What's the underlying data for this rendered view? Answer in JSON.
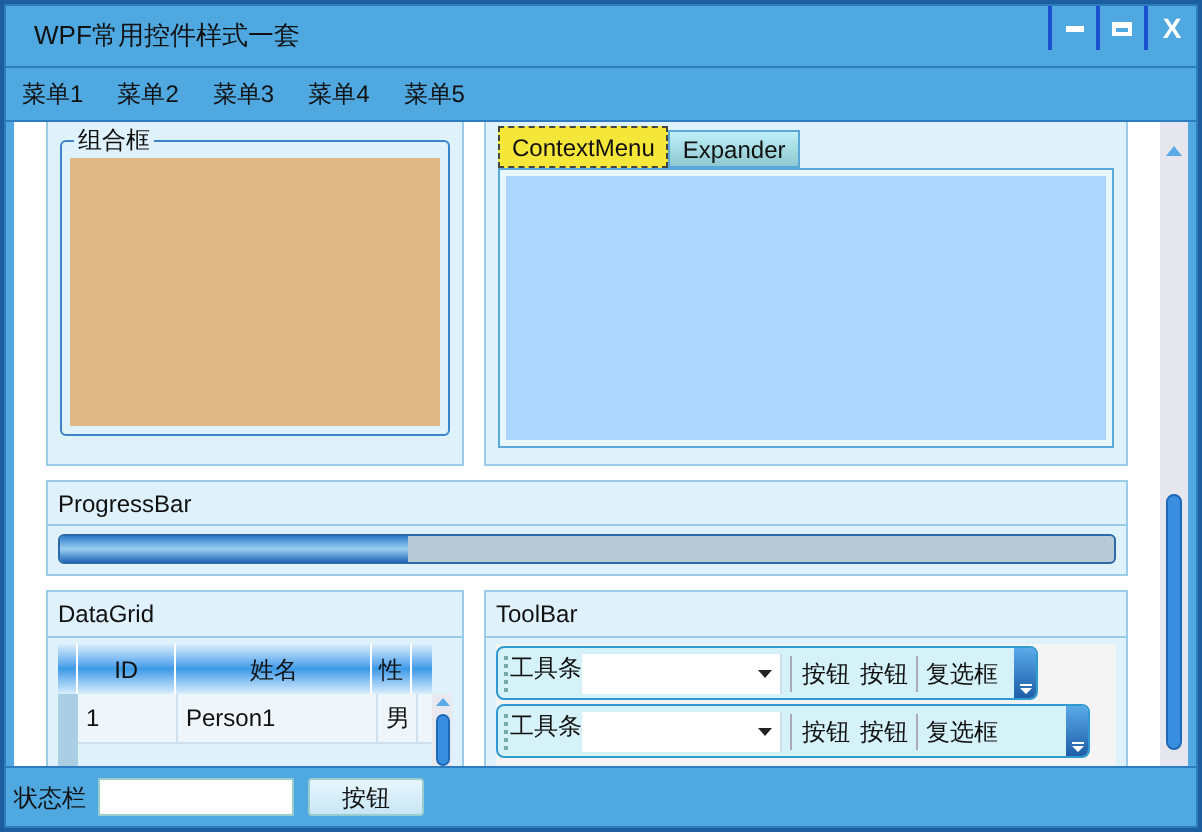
{
  "window": {
    "title": "WPF常用控件样式一套",
    "close_label": "X"
  },
  "menu": [
    {
      "label": "菜单1"
    },
    {
      "label": "菜单2"
    },
    {
      "label": "菜单3"
    },
    {
      "label": "菜单4"
    },
    {
      "label": "菜单5"
    }
  ],
  "groupbox": {
    "label": "组合框"
  },
  "tabs": [
    {
      "label": "ContextMenu",
      "selected": true
    },
    {
      "label": "Expander",
      "selected": false
    }
  ],
  "progress": {
    "title": "ProgressBar",
    "level": 0.33
  },
  "datagrid": {
    "title": "DataGrid",
    "columns": [
      "ID",
      "姓名",
      "性"
    ],
    "rows": [
      [
        "1",
        "Person1",
        "男"
      ]
    ]
  },
  "toolbar": {
    "title": "ToolBar",
    "bars": [
      {
        "label": "工具条",
        "buttons": [
          "按钮",
          "按钮"
        ],
        "checkbox": "复选框",
        "checked": false
      },
      {
        "label": "工具条",
        "buttons": [
          "按钮",
          "按钮"
        ],
        "checkbox": "复选框",
        "checked": false
      }
    ]
  },
  "status_bar": {
    "label": "状态栏",
    "button": "按钮"
  }
}
